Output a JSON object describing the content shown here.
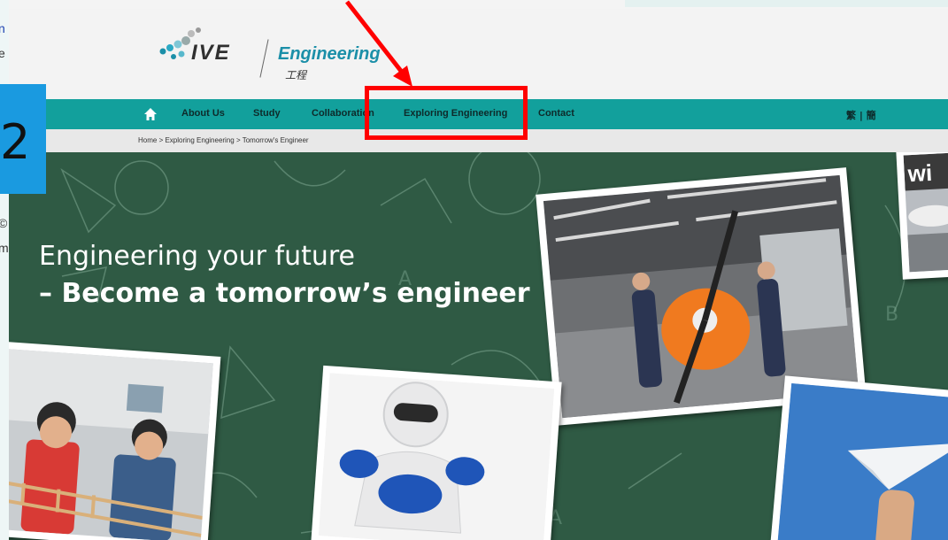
{
  "page_fragments": {
    "fragment_1": "n",
    "fragment_2": "e",
    "fragment_3": "©",
    "fragment_4": "m"
  },
  "logo": {
    "brand": "IVE",
    "department": "Engineering",
    "department_cn": "工程"
  },
  "nav": {
    "items": [
      {
        "label": "About Us"
      },
      {
        "label": "Study"
      },
      {
        "label": "Collaboration"
      },
      {
        "label": "Exploring Engineering"
      },
      {
        "label": "Contact"
      }
    ],
    "language_switch": "繁 | 簡"
  },
  "breadcrumb": "Home > Exploring Engineering > Tomorrow's Engineer",
  "hero": {
    "line1": "Engineering your future",
    "line2": "– Become a tomorrow’s engineer"
  },
  "annotation": {
    "step_number": "2",
    "highlight_color": "#ff0000",
    "badge_color": "#1a9ae0"
  },
  "colors": {
    "nav_bar": "#12a09c",
    "hero_background": "#2f5a44",
    "logo_accent": "#1b8fa8"
  },
  "icons": [
    "home-icon",
    "logo-dots-icon",
    "red-arrow"
  ]
}
